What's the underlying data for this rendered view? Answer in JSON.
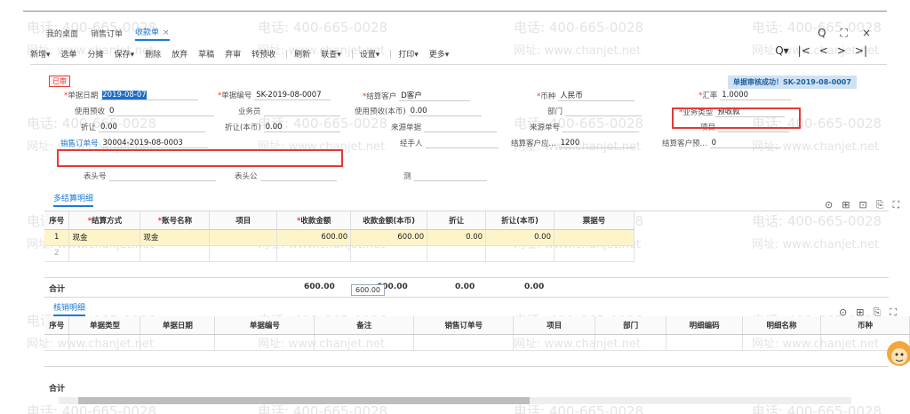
{
  "watermark": {
    "phone": "电话: 400-665-0028",
    "url": "网址: www.chanjet.net"
  },
  "tabs": [
    {
      "label": "我的桌面"
    },
    {
      "label": "销售订单"
    },
    {
      "label": "收款单"
    }
  ],
  "tab_close": "×",
  "window_buttons": [
    "Q",
    "⛶",
    "×"
  ],
  "toolbar": {
    "items": [
      "新增▾",
      "选单",
      "分摊",
      "保存▾",
      "删除",
      "放弃",
      "草稿",
      "弃审",
      "转预收",
      "刷新",
      "联查▾",
      "设置▾",
      "打印▾",
      "更多▾"
    ]
  },
  "nav": {
    "zoom": "Q▾",
    "first": "|<",
    "prev": "<",
    "next": ">",
    "last": ">|"
  },
  "status_badge": "已审",
  "success_msg": "单据审核成功！SK-2019-08-0007",
  "header_fields": {
    "doc_date_label": "单据日期",
    "doc_date": "2019-08-07",
    "doc_no_label": "单据编号",
    "doc_no": "SK-2019-08-0007",
    "customer_label": "结算客户",
    "customer": "D客户",
    "currency_label": "币种",
    "currency": "人民币",
    "rate_label": "汇率",
    "rate": "1.0000",
    "use_prepay_label": "使用预收",
    "use_prepay": "0",
    "salesman_label": "业务员",
    "salesman": "",
    "use_prepay_local_label": "使用预收(本币)",
    "use_prepay_local": "0.00",
    "dept_label": "部门",
    "dept": "",
    "biz_type_label": "业务类型",
    "biz_type": "预收款",
    "discount_label": "折让",
    "discount": "0.00",
    "discount_local_label": "折让(本币)",
    "discount_local": "0.00",
    "source_doc_label": "来源单据",
    "source_doc": "",
    "source_no_label": "来源单号",
    "source_no": "",
    "project_label": "项目",
    "project": "",
    "sales_order_label": "销售订单号",
    "sales_order": "30004-2019-08-0003",
    "handler_label": "经手人",
    "handler": "",
    "receivable_label": "结算客户应...",
    "receivable": "1200",
    "prepaid_label": "结算客户预...",
    "prepaid": "0",
    "header_label": "表头号",
    "header_val": "",
    "header_common_label": "表头公",
    "header_common_val": "",
    "test_label": "测",
    "test_val": ""
  },
  "section1": {
    "title": "多结算明细",
    "columns": [
      "序号",
      "结算方式",
      "账号名称",
      "项目",
      "收款金额",
      "收款金额(本币)",
      "折让",
      "折让(本币)",
      "票据号"
    ],
    "rows": [
      [
        "1",
        "现金",
        "现金",
        "",
        "600.00",
        "600.00",
        "0.00",
        "0.00",
        ""
      ],
      [
        "2",
        "",
        "",
        "",
        "",
        "",
        "",
        "",
        ""
      ]
    ],
    "tooltip": "600.00",
    "total_label": "合计",
    "totals": [
      "600.00",
      "600.00",
      "0.00",
      "0.00"
    ]
  },
  "section2": {
    "title": "核销明细",
    "columns": [
      "序号",
      "单据类型",
      "单据日期",
      "单据编号",
      "备注",
      "销售订单号",
      "项目",
      "部门",
      "明细编码",
      "明细名称",
      "币种"
    ],
    "total_label": "合计"
  },
  "icons_row": [
    "⊙",
    "⊞",
    "⊡",
    "⎘",
    "⛶"
  ],
  "icons_row2": [
    "⊙",
    "⊞",
    "⎘",
    "⛶"
  ],
  "colors": {
    "accent": "#1a7bd6",
    "highlight": "#e53935",
    "selected_row": "#fdf5c9"
  }
}
